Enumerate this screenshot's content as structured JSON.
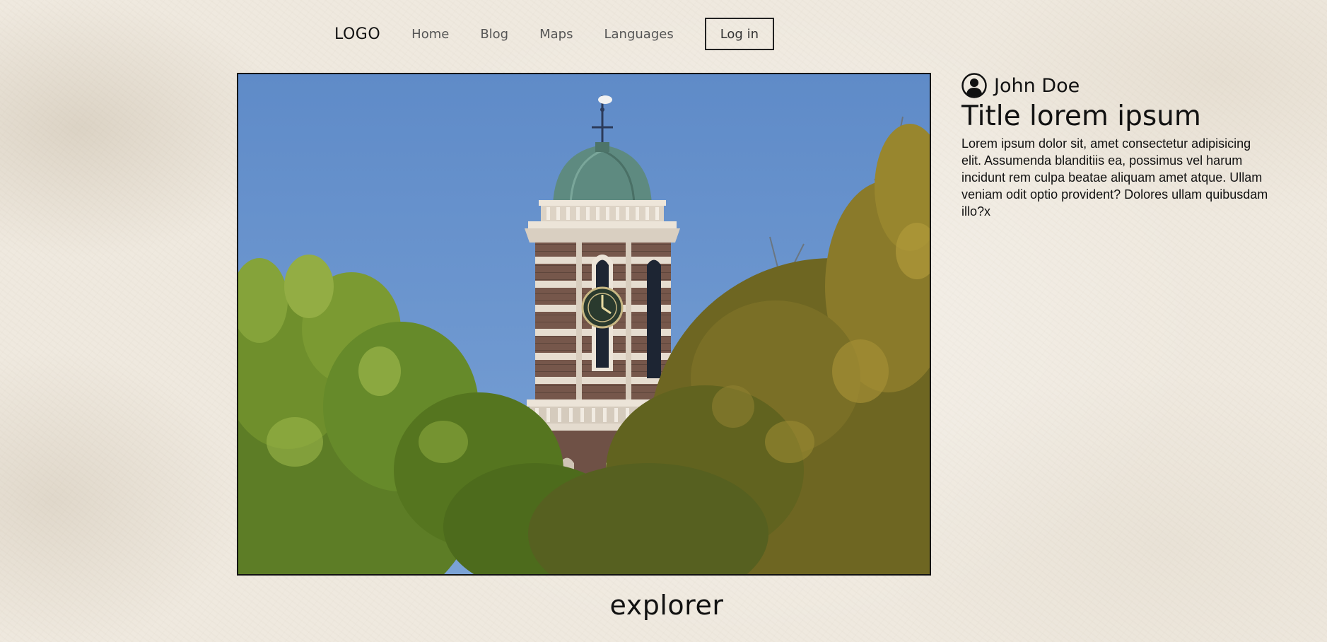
{
  "nav": {
    "logo": "LOGO",
    "links": [
      "Home",
      "Blog",
      "Maps",
      "Languages"
    ],
    "login_label": "Log in"
  },
  "hero": {
    "alt": "church tower with dome and clock behind trees",
    "colors": {
      "sky": "#6690c9",
      "dome": "#5e8a80",
      "brick": "#7a5a4e",
      "stone": "#e6ddd0",
      "tree_left": "#6f8f2c",
      "tree_right": "#8a7a2a"
    }
  },
  "caption": "explorer",
  "article": {
    "author_icon": "user-circle-icon",
    "author_name": "John Doe",
    "title": "Title lorem ipsum",
    "body": "Lorem ipsum dolor sit, amet consectetur adipisicing elit. Assumenda blanditiis ea, possimus vel harum incidunt rem culpa beatae aliquam amet atque. Ullam veniam odit optio provident? Dolores ullam quibusdam illo?x"
  }
}
